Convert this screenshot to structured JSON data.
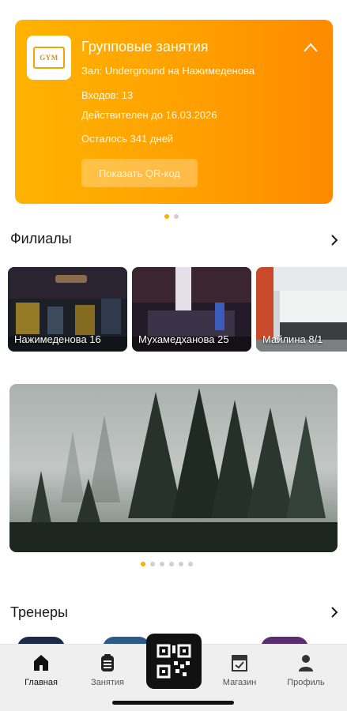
{
  "membership_card": {
    "logo_text": "GYM",
    "title": "Групповые занятия",
    "hall": "Зал: Underground на Нажимеденова",
    "entries": "Входов: 13",
    "valid_until": "Действителен до 16.03.2026",
    "days_left": "Осталось 341 дней",
    "qr_button_label": "Показать QR-код",
    "colors": {
      "gradient_start": "#ffb300",
      "gradient_end": "#ff8a00"
    }
  },
  "card_pager": {
    "count": 2,
    "active_index": 0
  },
  "branches_section": {
    "title": "Филиалы",
    "items": [
      {
        "label": "Нажимеденова 16"
      },
      {
        "label": "Мухамедханова 25"
      },
      {
        "label": "Майлина 8/1"
      }
    ]
  },
  "banner_pager": {
    "count": 6,
    "active_index": 0
  },
  "trainers_section": {
    "title": "Тренеры"
  },
  "bottom_nav": {
    "items": [
      {
        "label": "Главная",
        "icon": "home-icon",
        "active": true
      },
      {
        "label": "Занятия",
        "icon": "classes-icon",
        "active": false
      },
      {
        "label": "Магазин",
        "icon": "shop-icon",
        "active": false
      },
      {
        "label": "Профиль",
        "icon": "profile-icon",
        "active": false
      }
    ],
    "center_button_icon": "qr-code-icon"
  },
  "accent_color": "#f5b400"
}
